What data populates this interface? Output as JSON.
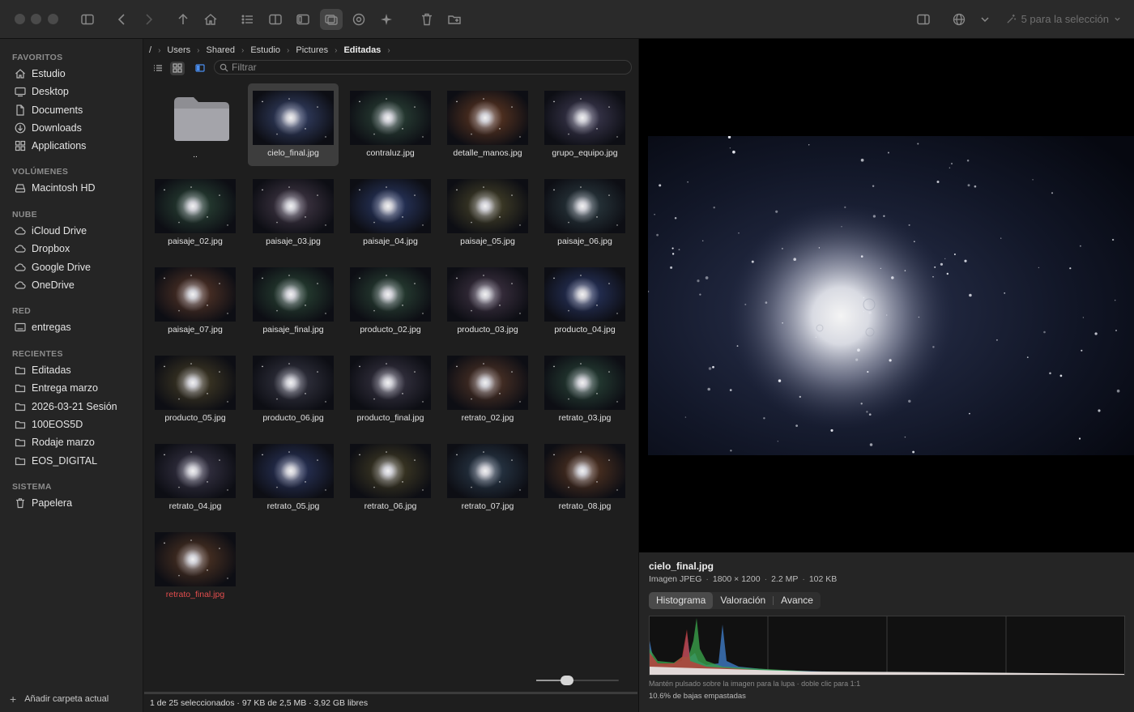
{
  "toolbar": {
    "selection_label": "5 para la selección"
  },
  "sidebar": {
    "sections": [
      {
        "label": "FAVORITOS",
        "items": [
          {
            "label": "Estudio",
            "icon": "home-icon"
          },
          {
            "label": "Desktop",
            "icon": "desktop-icon"
          },
          {
            "label": "Documents",
            "icon": "document-icon"
          },
          {
            "label": "Downloads",
            "icon": "download-icon"
          },
          {
            "label": "Applications",
            "icon": "applications-icon"
          }
        ]
      },
      {
        "label": "VOLÚMENES",
        "items": [
          {
            "label": "Macintosh HD",
            "icon": "drive-icon"
          }
        ]
      },
      {
        "label": "NUBE",
        "items": [
          {
            "label": "iCloud Drive",
            "icon": "cloud-icon"
          },
          {
            "label": "Dropbox",
            "icon": "cloud-icon"
          },
          {
            "label": "Google Drive",
            "icon": "cloud-icon"
          },
          {
            "label": "OneDrive",
            "icon": "cloud-icon"
          }
        ]
      },
      {
        "label": "RED",
        "items": [
          {
            "label": "entregas",
            "icon": "network-share-icon"
          }
        ]
      },
      {
        "label": "RECIENTES",
        "items": [
          {
            "label": "Editadas",
            "icon": "folder-icon"
          },
          {
            "label": "Entrega marzo",
            "icon": "folder-icon"
          },
          {
            "label": "2026-03-21 Sesión",
            "icon": "folder-icon"
          },
          {
            "label": "100EOS5D",
            "icon": "folder-icon"
          },
          {
            "label": "Rodaje marzo",
            "icon": "folder-icon"
          },
          {
            "label": "EOS_DIGITAL",
            "icon": "folder-icon"
          }
        ]
      },
      {
        "label": "SISTEMA",
        "items": [
          {
            "label": "Papelera",
            "icon": "trash-icon"
          }
        ]
      }
    ],
    "add_label": "Añadir carpeta actual"
  },
  "breadcrumb": [
    "/",
    "Users",
    "Shared",
    "Estudio",
    "Pictures",
    "Editadas"
  ],
  "filter": {
    "placeholder": "Filtrar",
    "value": ""
  },
  "files": [
    {
      "name": "..",
      "kind": "parent-folder"
    },
    {
      "name": "cielo_final.jpg",
      "selected": true,
      "tint": "#3a4872"
    },
    {
      "name": "contraluz.jpg",
      "tint": "#2f4a3c"
    },
    {
      "name": "detalle_manos.jpg",
      "tint": "#6a3d24"
    },
    {
      "name": "grupo_equipo.jpg",
      "tint": "#44405a"
    },
    {
      "name": "paisaje_02.jpg",
      "tint": "#2d4a3a"
    },
    {
      "name": "paisaje_03.jpg",
      "tint": "#4a3e4e"
    },
    {
      "name": "paisaje_04.jpg",
      "tint": "#2e3e6e"
    },
    {
      "name": "paisaje_05.jpg",
      "tint": "#4e4a2c"
    },
    {
      "name": "paisaje_06.jpg",
      "tint": "#2f4046"
    },
    {
      "name": "paisaje_07.jpg",
      "tint": "#5e3a2a"
    },
    {
      "name": "paisaje_final.jpg",
      "tint": "#2c4a38"
    },
    {
      "name": "producto_02.jpg",
      "tint": "#2e4a3a"
    },
    {
      "name": "producto_03.jpg",
      "tint": "#46384a"
    },
    {
      "name": "producto_04.jpg",
      "tint": "#2c3a6a"
    },
    {
      "name": "producto_05.jpg",
      "tint": "#4a4228"
    },
    {
      "name": "producto_06.jpg",
      "tint": "#3a3a48"
    },
    {
      "name": "producto_final.jpg",
      "tint": "#3e3a4a"
    },
    {
      "name": "retrato_02.jpg",
      "tint": "#5a3a2a"
    },
    {
      "name": "retrato_03.jpg",
      "tint": "#2c4a3c"
    },
    {
      "name": "retrato_04.jpg",
      "tint": "#3e3a4e"
    },
    {
      "name": "retrato_05.jpg",
      "tint": "#2e3a66"
    },
    {
      "name": "retrato_06.jpg",
      "tint": "#4a4428"
    },
    {
      "name": "retrato_07.jpg",
      "tint": "#2e4052"
    },
    {
      "name": "retrato_08.jpg",
      "tint": "#5e3a24"
    },
    {
      "name": "retrato_final.jpg",
      "tint": "#5a3a26",
      "label_color": "#e34d4d"
    }
  ],
  "status": {
    "text": "1 de 25 seleccionados · 97 KB de 2,5 MB · 3,92 GB libres"
  },
  "zoom": {
    "level": 0.35
  },
  "preview": {
    "filename": "cielo_final.jpg",
    "type": "Imagen JPEG",
    "dimensions": "1800 × 1200",
    "megapixels": "2.2 MP",
    "size": "102 KB",
    "tabs": [
      "Histograma",
      "Valoración",
      "Avance"
    ],
    "active_tab": 0,
    "hint": "Mantén pulsado sobre la imagen para la lupa · doble clic para 1:1",
    "shadows_note": "10.6% de bajas empastadas"
  }
}
